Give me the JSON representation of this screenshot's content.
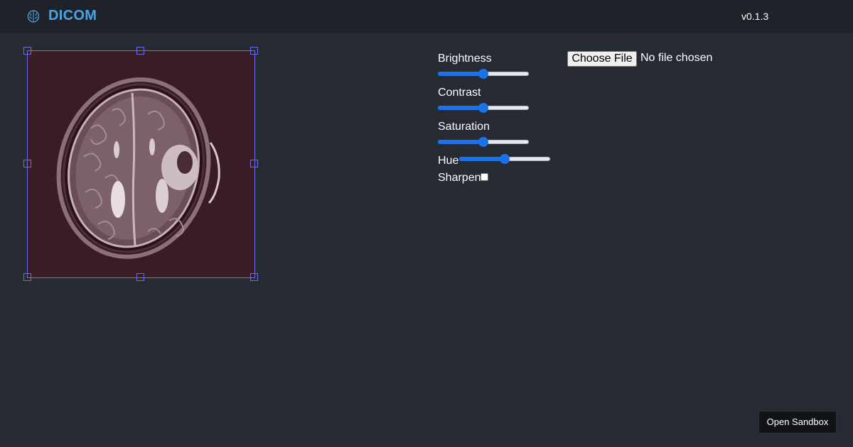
{
  "header": {
    "title": "DICOM",
    "logo_icon": "brain-icon",
    "version": "v0.1.3",
    "accent_color": "#4aa3e6"
  },
  "viewer": {
    "image_description_icon": "mri-brain-axial-image"
  },
  "controls": {
    "brightness": {
      "label": "Brightness",
      "value": 50
    },
    "contrast": {
      "label": "Contrast",
      "value": 50
    },
    "saturation": {
      "label": "Saturation",
      "value": 50
    },
    "hue": {
      "label": "Hue",
      "value": 50
    },
    "sharpen": {
      "label": "Sharpen",
      "checked": false
    }
  },
  "file_input": {
    "button_label": "Choose File",
    "status": "No file chosen"
  },
  "footer": {
    "sandbox_label": "Open Sandbox"
  }
}
